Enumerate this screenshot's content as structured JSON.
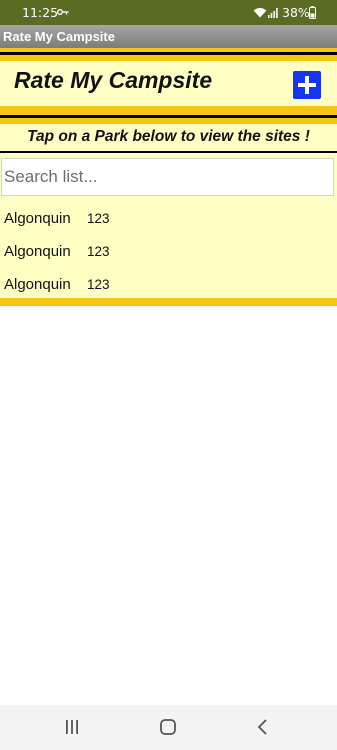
{
  "status_bar": {
    "time": "11:25",
    "battery": "38%",
    "icons": [
      "key-icon",
      "wifi-icon",
      "signal-icon",
      "battery-icon"
    ]
  },
  "window": {
    "title": "Rate My Campsite"
  },
  "header": {
    "title": "Rate My Campsite",
    "add_button_icon": "plus-icon"
  },
  "instruction": "Tap on a Park below to view the sites !",
  "search": {
    "placeholder": "Search list...",
    "value": ""
  },
  "parks": [
    {
      "name": "Algonquin",
      "value": "123"
    },
    {
      "name": "Algonquin",
      "value": "123"
    },
    {
      "name": "Algonquin",
      "value": "123"
    }
  ],
  "nav_bar": {
    "buttons": [
      "recent-apps-icon",
      "home-icon",
      "back-icon"
    ]
  },
  "colors": {
    "status_bar": "#5a6b24",
    "title_bar": "#8c8c8c",
    "app_background": "#ffffc4",
    "stripe_gold": "#f7c511",
    "stripe_black": "#000000",
    "add_button": "#1434f0"
  }
}
